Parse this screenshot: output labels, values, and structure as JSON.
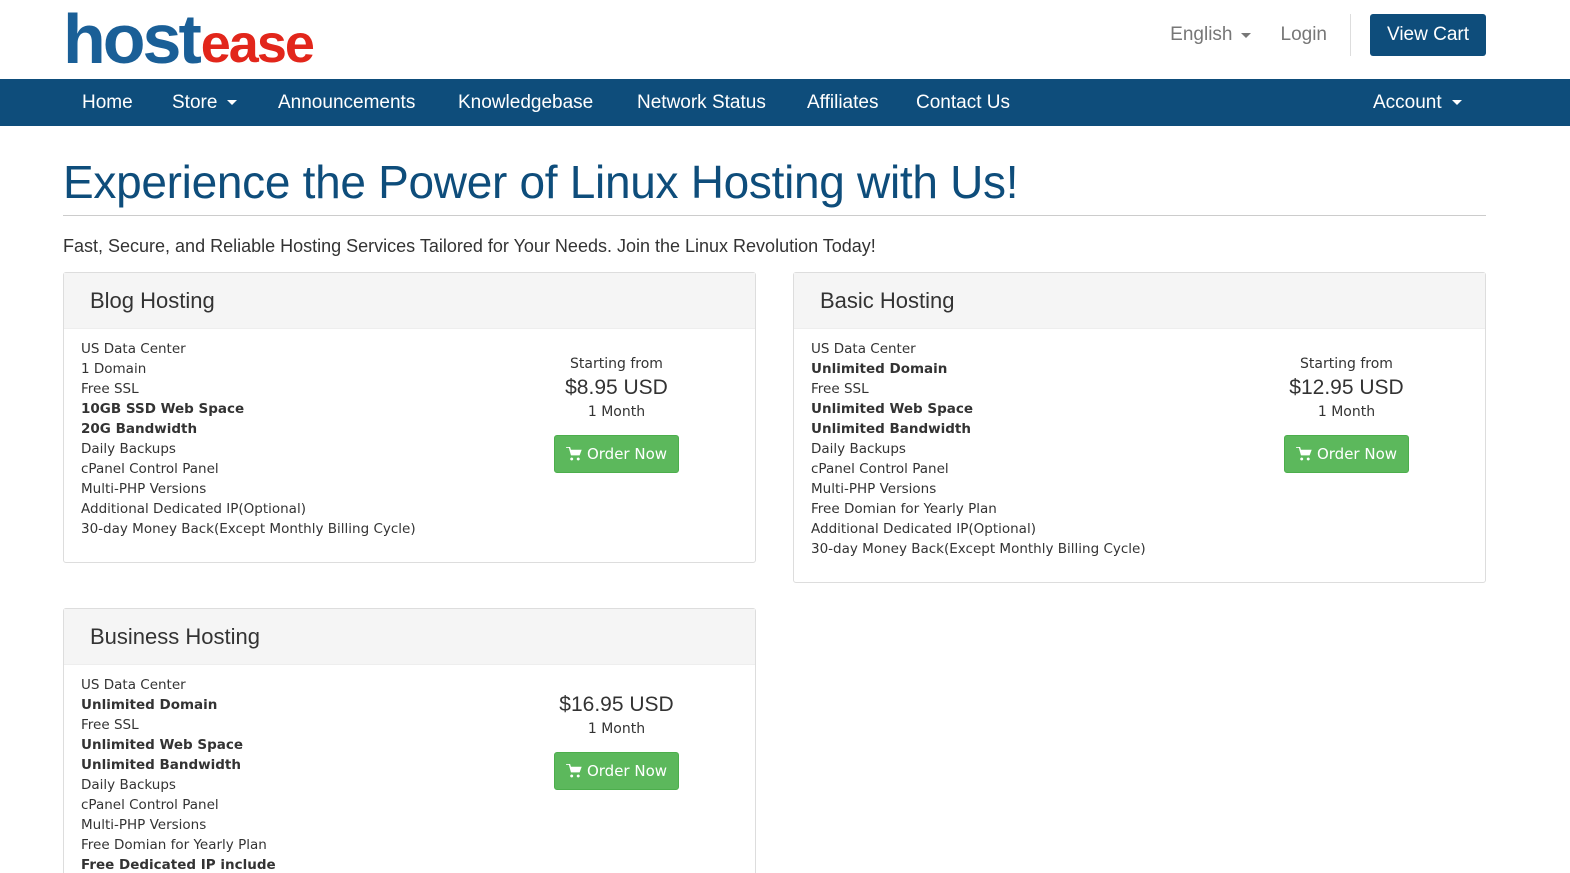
{
  "brand": {
    "logo_host": "hos",
    "logo_t": "t",
    "logo_ease": "ease"
  },
  "top_links": {
    "language": "English",
    "login": "Login",
    "view_cart": "View Cart"
  },
  "nav": {
    "items": [
      "Home",
      "Store",
      "Announcements",
      "Knowledgebase",
      "Network Status",
      "Affiliates",
      "Contact Us"
    ],
    "account": "Account"
  },
  "page": {
    "title": "Experience the Power of Linux Hosting with Us!",
    "tagline": "Fast, Secure, and Reliable Hosting Services Tailored for Your Needs. Join the Linux Revolution Today!"
  },
  "products": [
    {
      "name": "Blog Hosting",
      "starting_from": "Starting from",
      "price": "$8.95 USD",
      "cycle": "1 Month",
      "order_label": "Order Now",
      "features": [
        {
          "text": "US Data Center",
          "bold": false
        },
        {
          "text": "1 Domain",
          "bold": false
        },
        {
          "text": "Free SSL",
          "bold": false
        },
        {
          "text": "10GB SSD Web Space",
          "bold": true
        },
        {
          "text": "20G Bandwidth",
          "bold": true
        },
        {
          "text": "Daily Backups",
          "bold": false
        },
        {
          "text": "cPanel Control Panel",
          "bold": false
        },
        {
          "text": "Multi-PHP Versions",
          "bold": false
        },
        {
          "text": "Additional Dedicated IP(Optional)",
          "bold": false
        },
        {
          "text": "30-day Money Back(Except Monthly Billing Cycle)",
          "bold": false
        }
      ]
    },
    {
      "name": "Basic Hosting",
      "starting_from": "Starting from",
      "price": "$12.95 USD",
      "cycle": "1 Month",
      "order_label": "Order Now",
      "features": [
        {
          "text": "US Data Center",
          "bold": false
        },
        {
          "text": "Unlimited Domain",
          "bold": true
        },
        {
          "text": "Free SSL",
          "bold": false
        },
        {
          "text": "Unlimited Web Space",
          "bold": true
        },
        {
          "text": "Unlimited Bandwidth",
          "bold": true
        },
        {
          "text": "Daily Backups",
          "bold": false
        },
        {
          "text": "cPanel Control Panel",
          "bold": false
        },
        {
          "text": "Multi-PHP Versions",
          "bold": false
        },
        {
          "text": "Free Domian for Yearly Plan",
          "bold": false
        },
        {
          "text": "Additional Dedicated IP(Optional)",
          "bold": false
        },
        {
          "text": "30-day Money Back(Except Monthly Billing Cycle)",
          "bold": false
        }
      ]
    },
    {
      "name": "Business Hosting",
      "price": "$16.95 USD",
      "cycle": "1 Month",
      "order_label": "Order Now",
      "features": [
        {
          "text": "US Data Center",
          "bold": false
        },
        {
          "text": "Unlimited Domain",
          "bold": true
        },
        {
          "text": "Free SSL",
          "bold": false
        },
        {
          "text": "Unlimited Web Space",
          "bold": true
        },
        {
          "text": "Unlimited Bandwidth",
          "bold": true
        },
        {
          "text": "Daily Backups",
          "bold": false
        },
        {
          "text": "cPanel Control Panel",
          "bold": false
        },
        {
          "text": "Multi-PHP Versions",
          "bold": false
        },
        {
          "text": "Free Domian for Yearly Plan",
          "bold": false
        },
        {
          "text": "Free Dedicated IP include",
          "bold": true
        }
      ]
    }
  ],
  "icons": {
    "cart": "shopping-cart-icon",
    "caret": "caret-down-icon"
  },
  "colors": {
    "brand_blue": "#0e4d7b",
    "order_green": "#5cb85c",
    "logo_red": "#e2261b"
  }
}
